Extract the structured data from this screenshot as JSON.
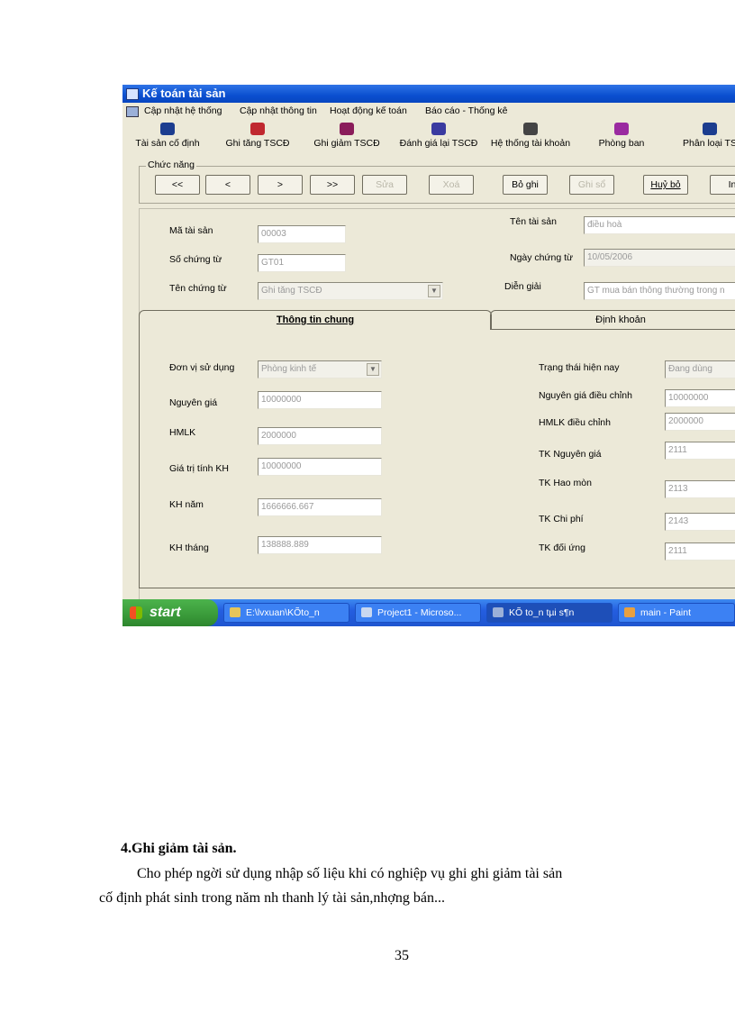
{
  "window": {
    "title": "Kế toán tài sản"
  },
  "menu": [
    "Cập nhật hệ thống",
    "Cập nhật thông tin",
    "Hoạt động kế toán",
    "Báo cáo - Thống kê"
  ],
  "toolbar": [
    {
      "label": "Tài sản cố định",
      "icon": "book-icon",
      "color": "#1c3d8f"
    },
    {
      "label": "Ghi tăng TSCĐ",
      "icon": "add-asset-icon",
      "color": "#c0282f"
    },
    {
      "label": "Ghi giảm TSCĐ",
      "icon": "reduce-asset-icon",
      "color": "#8a1c5a"
    },
    {
      "label": "Đánh giá lại TSCĐ",
      "icon": "reassess-icon",
      "color": "#3a3aa0"
    },
    {
      "label": "Hệ thống tài khoản",
      "icon": "accounts-icon",
      "color": "#444444"
    },
    {
      "label": "Phòng ban",
      "icon": "department-icon",
      "color": "#9a2aa0"
    },
    {
      "label": "Phân loại TS",
      "icon": "category-icon",
      "color": "#1c3d8f"
    }
  ],
  "functions": {
    "group_label": "Chức năng",
    "buttons": [
      "<<",
      "<",
      ">",
      ">>",
      "Sửa",
      "Xoá",
      "Bỏ ghi",
      "Ghi sổ",
      "Huỷ bỏ",
      "In"
    ]
  },
  "header_form": {
    "ma_tai_san": {
      "label": "Mã tài sản",
      "value": "00003"
    },
    "so_chung_tu": {
      "label": "Số chứng từ",
      "value": "GT01"
    },
    "ten_chung_tu": {
      "label": "Tên chứng từ",
      "value": "Ghi tăng TSCĐ"
    },
    "ten_tai_san": {
      "label": "Tên tài sản",
      "value": "điều hoà"
    },
    "ngay_chung_tu": {
      "label": "Ngày chứng từ",
      "value": "10/05/2006"
    },
    "dien_giai": {
      "label": "Diễn giải",
      "value": "GT mua bán thông thường trong n"
    }
  },
  "tabs": [
    "Thông tin chung",
    "Định khoản"
  ],
  "general": {
    "don_vi_su_dung": {
      "label": "Đơn vị sử dụng",
      "value": "Phòng kinh tế"
    },
    "nguyen_gia": {
      "label": "Nguyên giá",
      "value": "10000000"
    },
    "hmlk": {
      "label": "HMLK",
      "value": "2000000"
    },
    "gia_tri_tinh_kh": {
      "label": "Giá trị tính KH",
      "value": "10000000"
    },
    "kh_nam": {
      "label": "KH năm",
      "value": "1666666.667"
    },
    "kh_thang": {
      "label": "KH tháng",
      "value": "138888.889"
    },
    "trang_thai": {
      "label": "Trạng thái hiện nay",
      "value": "Đang dùng"
    },
    "nguyen_gia_dc": {
      "label": "Nguyên giá điều chỉnh",
      "value": "10000000"
    },
    "hmlk_dc": {
      "label": "HMLK điều chỉnh",
      "value": "2000000"
    },
    "tk_nguyen_gia": {
      "label": "TK Nguyên giá",
      "value": "2111"
    },
    "tk_hao_mon": {
      "label": "TK Hao mòn",
      "value": "2113"
    },
    "tk_chi_phi": {
      "label": "TK Chi phí",
      "value": "2143"
    },
    "tk_doi_ung": {
      "label": "TK đối ứng",
      "value": "2111"
    }
  },
  "taskbar": {
    "start": "start",
    "tasks": [
      "E:\\lvxuan\\KÕto_n",
      "Project1 - Microso...",
      "KÕ to_n tµi s¶n",
      "main - Paint"
    ]
  },
  "doc": {
    "heading": "4.Ghi giảm tài sản.",
    "para_line1": "Cho phép ngời   sử dụng nhập số liệu khi có nghiệp vụ ghi ghi giảm tài sản",
    "para_line2": "cố định phát sinh trong năm nh   thanh lý tài sản,nhợng   bán...",
    "page_number": "35"
  }
}
